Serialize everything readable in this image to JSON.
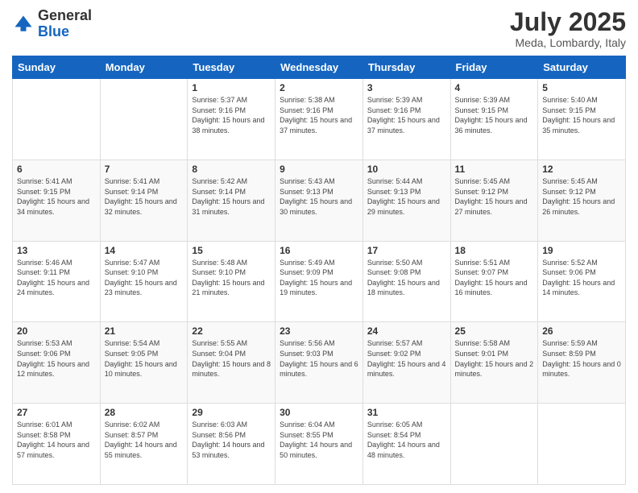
{
  "header": {
    "logo": {
      "line1": "General",
      "line2": "Blue"
    },
    "month": "July 2025",
    "location": "Meda, Lombardy, Italy"
  },
  "weekdays": [
    "Sunday",
    "Monday",
    "Tuesday",
    "Wednesday",
    "Thursday",
    "Friday",
    "Saturday"
  ],
  "weeks": [
    [
      null,
      null,
      {
        "day": 1,
        "sunrise": "5:37 AM",
        "sunset": "9:16 PM",
        "daylight": "15 hours and 38 minutes."
      },
      {
        "day": 2,
        "sunrise": "5:38 AM",
        "sunset": "9:16 PM",
        "daylight": "15 hours and 37 minutes."
      },
      {
        "day": 3,
        "sunrise": "5:39 AM",
        "sunset": "9:16 PM",
        "daylight": "15 hours and 37 minutes."
      },
      {
        "day": 4,
        "sunrise": "5:39 AM",
        "sunset": "9:15 PM",
        "daylight": "15 hours and 36 minutes."
      },
      {
        "day": 5,
        "sunrise": "5:40 AM",
        "sunset": "9:15 PM",
        "daylight": "15 hours and 35 minutes."
      }
    ],
    [
      {
        "day": 6,
        "sunrise": "5:41 AM",
        "sunset": "9:15 PM",
        "daylight": "15 hours and 34 minutes."
      },
      {
        "day": 7,
        "sunrise": "5:41 AM",
        "sunset": "9:14 PM",
        "daylight": "15 hours and 32 minutes."
      },
      {
        "day": 8,
        "sunrise": "5:42 AM",
        "sunset": "9:14 PM",
        "daylight": "15 hours and 31 minutes."
      },
      {
        "day": 9,
        "sunrise": "5:43 AM",
        "sunset": "9:13 PM",
        "daylight": "15 hours and 30 minutes."
      },
      {
        "day": 10,
        "sunrise": "5:44 AM",
        "sunset": "9:13 PM",
        "daylight": "15 hours and 29 minutes."
      },
      {
        "day": 11,
        "sunrise": "5:45 AM",
        "sunset": "9:12 PM",
        "daylight": "15 hours and 27 minutes."
      },
      {
        "day": 12,
        "sunrise": "5:45 AM",
        "sunset": "9:12 PM",
        "daylight": "15 hours and 26 minutes."
      }
    ],
    [
      {
        "day": 13,
        "sunrise": "5:46 AM",
        "sunset": "9:11 PM",
        "daylight": "15 hours and 24 minutes."
      },
      {
        "day": 14,
        "sunrise": "5:47 AM",
        "sunset": "9:10 PM",
        "daylight": "15 hours and 23 minutes."
      },
      {
        "day": 15,
        "sunrise": "5:48 AM",
        "sunset": "9:10 PM",
        "daylight": "15 hours and 21 minutes."
      },
      {
        "day": 16,
        "sunrise": "5:49 AM",
        "sunset": "9:09 PM",
        "daylight": "15 hours and 19 minutes."
      },
      {
        "day": 17,
        "sunrise": "5:50 AM",
        "sunset": "9:08 PM",
        "daylight": "15 hours and 18 minutes."
      },
      {
        "day": 18,
        "sunrise": "5:51 AM",
        "sunset": "9:07 PM",
        "daylight": "15 hours and 16 minutes."
      },
      {
        "day": 19,
        "sunrise": "5:52 AM",
        "sunset": "9:06 PM",
        "daylight": "15 hours and 14 minutes."
      }
    ],
    [
      {
        "day": 20,
        "sunrise": "5:53 AM",
        "sunset": "9:06 PM",
        "daylight": "15 hours and 12 minutes."
      },
      {
        "day": 21,
        "sunrise": "5:54 AM",
        "sunset": "9:05 PM",
        "daylight": "15 hours and 10 minutes."
      },
      {
        "day": 22,
        "sunrise": "5:55 AM",
        "sunset": "9:04 PM",
        "daylight": "15 hours and 8 minutes."
      },
      {
        "day": 23,
        "sunrise": "5:56 AM",
        "sunset": "9:03 PM",
        "daylight": "15 hours and 6 minutes."
      },
      {
        "day": 24,
        "sunrise": "5:57 AM",
        "sunset": "9:02 PM",
        "daylight": "15 hours and 4 minutes."
      },
      {
        "day": 25,
        "sunrise": "5:58 AM",
        "sunset": "9:01 PM",
        "daylight": "15 hours and 2 minutes."
      },
      {
        "day": 26,
        "sunrise": "5:59 AM",
        "sunset": "8:59 PM",
        "daylight": "15 hours and 0 minutes."
      }
    ],
    [
      {
        "day": 27,
        "sunrise": "6:01 AM",
        "sunset": "8:58 PM",
        "daylight": "14 hours and 57 minutes."
      },
      {
        "day": 28,
        "sunrise": "6:02 AM",
        "sunset": "8:57 PM",
        "daylight": "14 hours and 55 minutes."
      },
      {
        "day": 29,
        "sunrise": "6:03 AM",
        "sunset": "8:56 PM",
        "daylight": "14 hours and 53 minutes."
      },
      {
        "day": 30,
        "sunrise": "6:04 AM",
        "sunset": "8:55 PM",
        "daylight": "14 hours and 50 minutes."
      },
      {
        "day": 31,
        "sunrise": "6:05 AM",
        "sunset": "8:54 PM",
        "daylight": "14 hours and 48 minutes."
      },
      null,
      null
    ]
  ]
}
